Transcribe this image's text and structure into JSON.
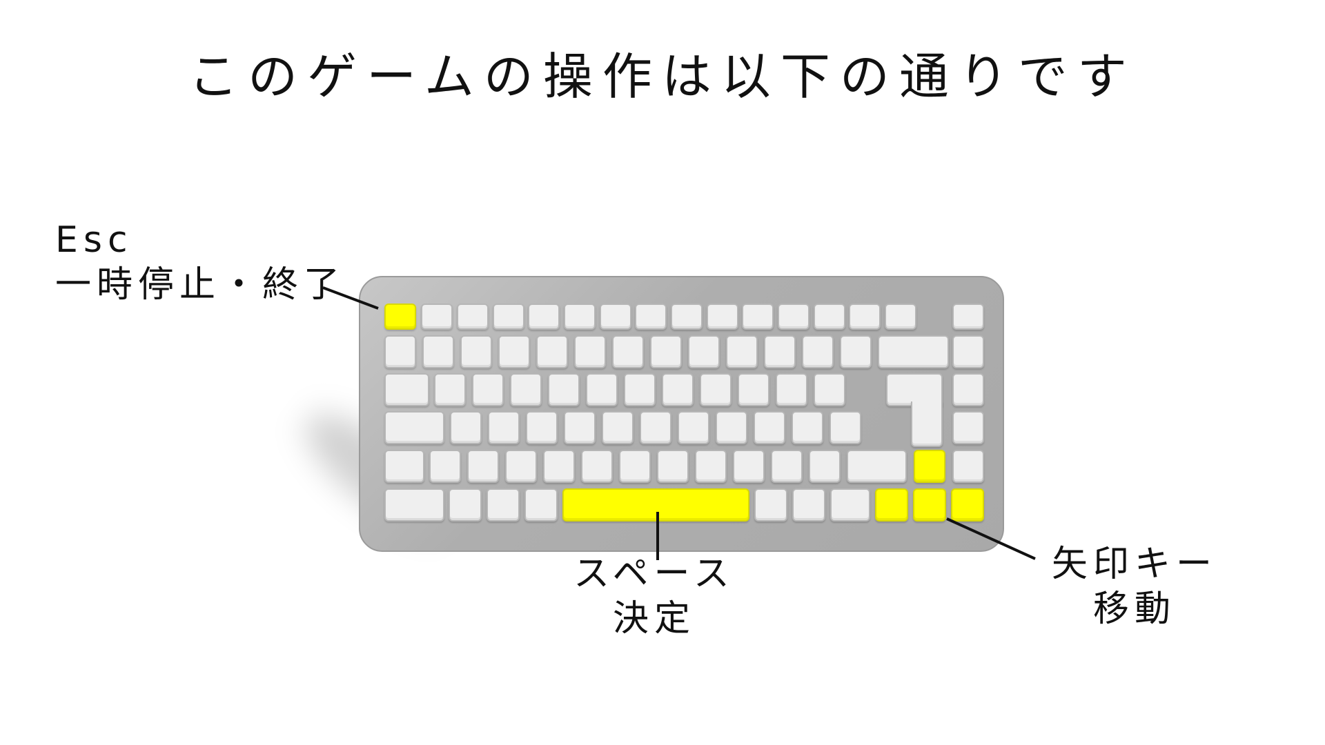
{
  "title": "このゲームの操作は以下の通りです",
  "labels": {
    "esc_key": "Esc",
    "esc_action": "一時停止・終了",
    "space_key": "スペース",
    "space_action": "決定",
    "arrow_key": "矢印キー",
    "arrow_action": "移動"
  },
  "highlighted_keys": [
    "Esc",
    "Space",
    "Up",
    "Left",
    "Down",
    "Right"
  ],
  "colors": {
    "highlight": "#ffff00",
    "key": "#efefef",
    "keyboard": "#aeaeae",
    "text": "#111111"
  }
}
